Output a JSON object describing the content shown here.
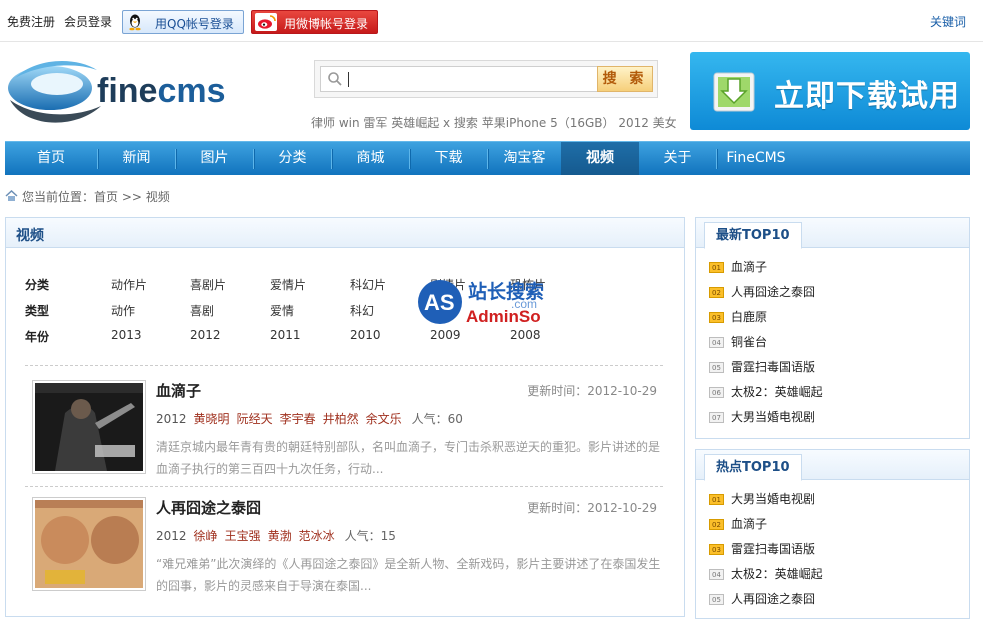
{
  "topbar": {
    "register": "免费注册",
    "login": "会员登录",
    "qq_login": "用QQ帐号登录",
    "weibo_login": "用微博帐号登录",
    "keywords": "关键词"
  },
  "logo": {
    "text_a": "fine",
    "text_b": "cms"
  },
  "search": {
    "placeholder": "",
    "button": "搜 索",
    "hot_words": "律师 win 雷军 英雄崛起 x 搜索 苹果iPhone 5（16GB） 2012 美女"
  },
  "download_banner": "立即下载试用",
  "nav": {
    "items": [
      "首页",
      "新闻",
      "图片",
      "分类",
      "商城",
      "下载",
      "淘宝客",
      "视频",
      "关于",
      "FineCMS"
    ],
    "active": "视频"
  },
  "breadcrumb": "您当前位置：首页 >> 视频",
  "main": {
    "title": "视频",
    "filters": {
      "rows": [
        {
          "label": "分类",
          "values": [
            "动作片",
            "喜剧片",
            "爱情片",
            "科幻片",
            "剧情片",
            "恐怖片"
          ]
        },
        {
          "label": "类型",
          "values": [
            "动作",
            "喜剧",
            "爱情",
            "科幻",
            "",
            ""
          ]
        },
        {
          "label": "年份",
          "values": [
            "2013",
            "2012",
            "2011",
            "2010",
            "2009",
            "2008"
          ]
        }
      ]
    },
    "films": [
      {
        "title": "血滴子",
        "updated": "更新时间：2012-10-29",
        "year": "2012",
        "actors": [
          "黄晓明",
          "阮经天",
          "李宇春",
          "井柏然",
          "余文乐"
        ],
        "popularity": "人气：60",
        "desc": "清廷京城内最年青有贵的朝廷特别部队，名叫血滴子，专门击杀釈恶逆天的重犯。影片讲述的是血滴子执行的第三百四十九次任务，行动..."
      },
      {
        "title": "人再囧途之泰囧",
        "updated": "更新时间：2012-10-29",
        "year": "2012",
        "actors": [
          "徐峥",
          "王宝强",
          "黄渤",
          "范冰冰"
        ],
        "popularity": "人气：15",
        "desc": "“难兄难弟”此次演绎的《人再囧途之泰囧》是全新人物、全新戏码，影片主要讲述了在泰国发生的囧事，影片的灵感来自于导演在泰国..."
      }
    ]
  },
  "side_latest": {
    "title": "最新TOP10",
    "items": [
      {
        "num": "01",
        "name": "血滴子"
      },
      {
        "num": "02",
        "name": "人再囧途之泰囧"
      },
      {
        "num": "03",
        "name": "白鹿原"
      },
      {
        "num": "04",
        "name": "铜雀台"
      },
      {
        "num": "05",
        "name": "雷霆扫毒国语版"
      },
      {
        "num": "06",
        "name": "太极2：英雄崛起"
      },
      {
        "num": "07",
        "name": "大男当婚电视剧"
      }
    ]
  },
  "side_hot": {
    "title": "热点TOP10",
    "items": [
      {
        "num": "01",
        "name": "大男当婚电视剧"
      },
      {
        "num": "02",
        "name": "血滴子"
      },
      {
        "num": "03",
        "name": "雷霆扫毒国语版"
      },
      {
        "num": "04",
        "name": "太极2：英雄崛起"
      },
      {
        "num": "05",
        "name": "人再囧途之泰囧"
      }
    ]
  },
  "watermark": {
    "text_a": "AS",
    "text_b": "站长搜索",
    "text_c": "AdminSo",
    "text_d": ".com"
  },
  "colors": {
    "nav_blue": "#1173bd",
    "actor_red": "#a0311f",
    "accent_orange": "#fbbf2a"
  }
}
